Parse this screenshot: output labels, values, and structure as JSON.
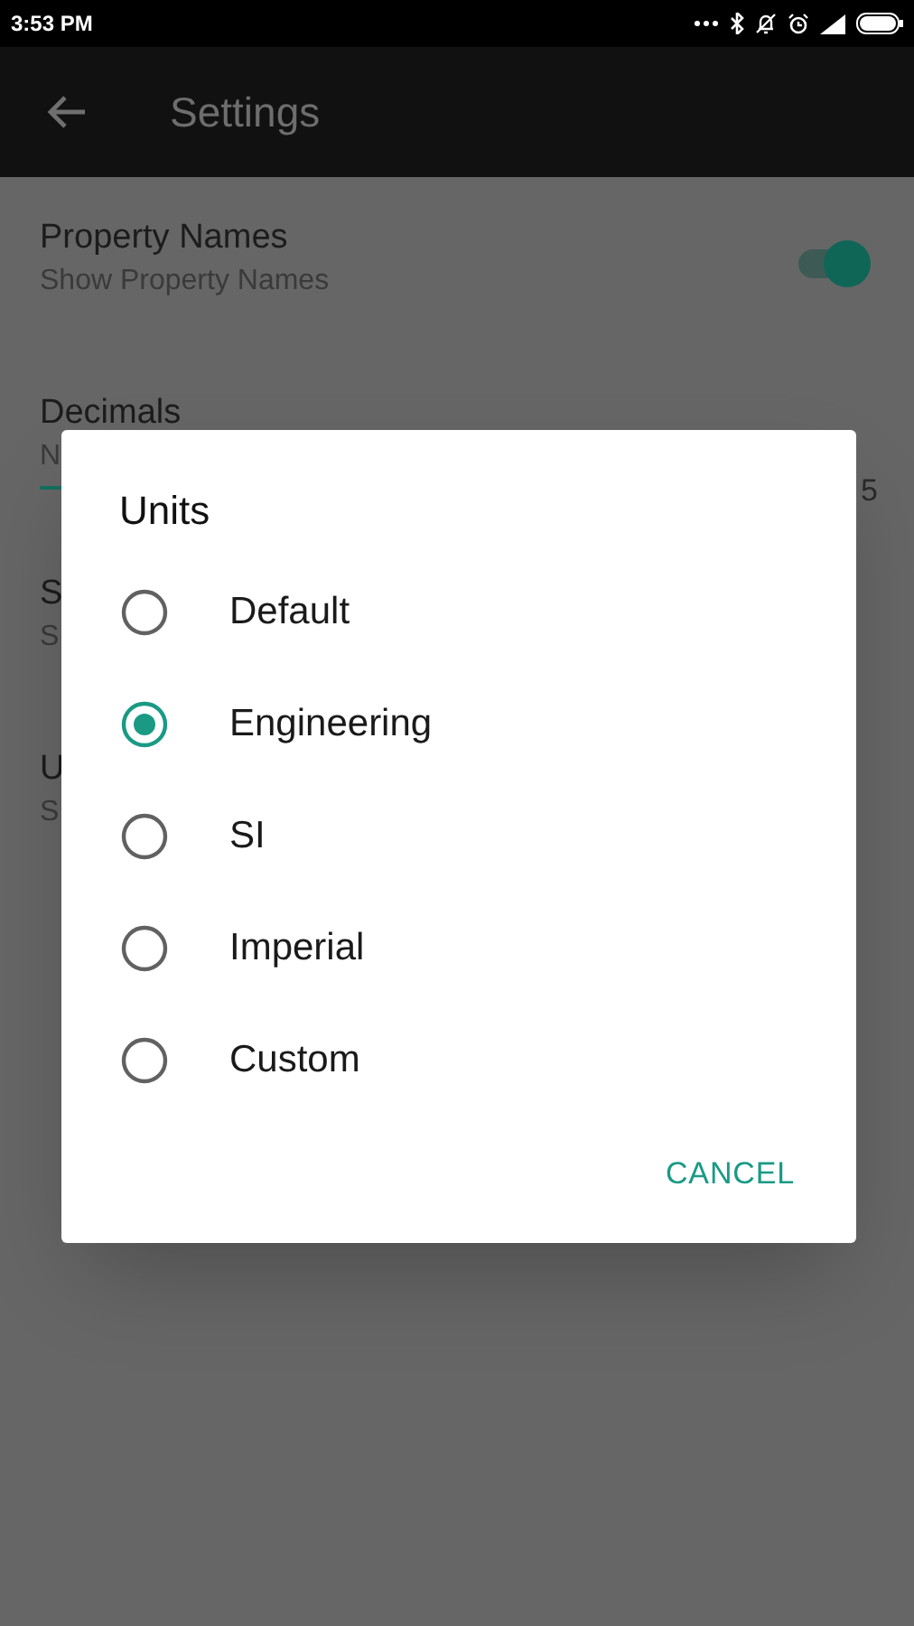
{
  "status_bar": {
    "time": "3:53 PM"
  },
  "app_bar": {
    "title": "Settings"
  },
  "settings": [
    {
      "kind": "switch",
      "title": "Property Names",
      "subtitle": "Show Property Names",
      "on": true
    },
    {
      "kind": "slider",
      "title": "Decimals",
      "subtitle": "N",
      "level": 0.03,
      "reading": "5"
    },
    {
      "kind": "plain",
      "title": "S",
      "subtitle": "S"
    },
    {
      "kind": "plain",
      "title": "U",
      "subtitle": "S"
    }
  ],
  "dialog": {
    "title": "Units",
    "options": [
      {
        "label": "Default",
        "selected": false
      },
      {
        "label": "Engineering",
        "selected": true
      },
      {
        "label": "SI",
        "selected": false
      },
      {
        "label": "Imperial",
        "selected": false
      },
      {
        "label": "Custom",
        "selected": false
      }
    ],
    "buttons": [
      "CANCEL"
    ]
  }
}
